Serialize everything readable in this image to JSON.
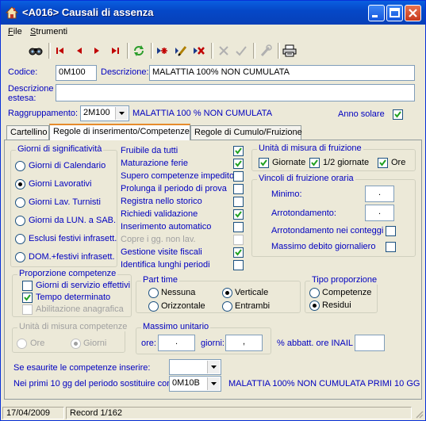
{
  "window": {
    "title": "<A016> Causali di assenza"
  },
  "menu": [
    {
      "label": "File",
      "key": "F",
      "rest": "ile"
    },
    {
      "label": "Strumenti",
      "key": "S",
      "rest": "trumenti"
    }
  ],
  "toolbar": [
    "search-icon",
    "first-record-icon",
    "prev-record-icon",
    "next-record-icon",
    "last-record-icon",
    "refresh-icon",
    "new-record-icon",
    "edit-icon",
    "delete-icon",
    "cancel-icon",
    "confirm-icon",
    "tool-icon",
    "print-icon"
  ],
  "header": {
    "codice_label": "Codice:",
    "codice_value": "0M100",
    "descrizione_label": "Descrizione:",
    "descrizione_value": "MALATTIA 100% NON CUMULATA",
    "desc_estesa_label1": "Descrizione",
    "desc_estesa_label2": "estesa:",
    "desc_estesa_value": "",
    "raggruppamento_label": "Raggruppamento:",
    "raggruppamento_value": "2M100",
    "raggruppamento_desc": "MALATTIA 100 % NON CUMULATA",
    "anno_solare_label": "Anno solare",
    "anno_solare_checked": true
  },
  "tabs": [
    "Cartellino",
    "Regole di inserimento/Competenze",
    "Regole di Cumulo/Fruizione"
  ],
  "active_tab": 1,
  "giorni": {
    "title": "Giorni di significatività",
    "options": [
      "Giorni di Calendario",
      "Giorni Lavorativi",
      "Giorni Lav. Turnisti",
      "Giorni da LUN. a SAB.",
      "Esclusi festivi infrasett.",
      "DOM.+festivi infrasett."
    ],
    "selected": 1
  },
  "flags": [
    {
      "label": "Fruibile da tutti",
      "checked": true,
      "disabled": false
    },
    {
      "label": "Maturazione ferie",
      "checked": true,
      "disabled": false
    },
    {
      "label": "Supero competenze impedito",
      "checked": false,
      "disabled": false
    },
    {
      "label": "Prolunga il periodo di prova",
      "checked": false,
      "disabled": false
    },
    {
      "label": "Registra nello storico",
      "checked": false,
      "disabled": false
    },
    {
      "label": "Richiedi validazione",
      "checked": true,
      "disabled": false
    },
    {
      "label": "Inserimento automatico",
      "checked": false,
      "disabled": false
    },
    {
      "label": "Copre i gg. non lav.",
      "checked": false,
      "disabled": true
    },
    {
      "label": "Gestione visite fiscali",
      "checked": true,
      "disabled": false
    },
    {
      "label": "Identifica lunghi periodi",
      "checked": false,
      "disabled": false
    }
  ],
  "unita_fruizione": {
    "title": "Unità di misura di fruizione",
    "options": [
      {
        "label": "Giornate",
        "checked": true
      },
      {
        "label": "1/2 giornate",
        "checked": true
      },
      {
        "label": "Ore",
        "checked": true
      }
    ]
  },
  "vincoli": {
    "title": "Vincoli di fruizione oraria",
    "minimo_label": "Minimo:",
    "minimo_value": ".",
    "arrotondamento_label": "Arrotondamento:",
    "arrotondamento_value": ".",
    "arr_conteggi_label": "Arrotondamento nei conteggi",
    "arr_conteggi_checked": false,
    "massimo_label": "Massimo debito giornaliero",
    "massimo_checked": false
  },
  "proporzione": {
    "title": "Proporzione competenze",
    "options": [
      {
        "label": "Giorni di servizio effettivi",
        "checked": false,
        "disabled": false
      },
      {
        "label": "Tempo determinato",
        "checked": true,
        "disabled": false
      },
      {
        "label": "Abilitazione anagrafica",
        "checked": false,
        "disabled": true
      }
    ]
  },
  "part_time": {
    "title": "Part time",
    "options": [
      "Nessuna",
      "Verticale",
      "Orizzontale",
      "Entrambi"
    ],
    "selected": 1
  },
  "tipo_proporzione": {
    "title": "Tipo proporzione",
    "options": [
      "Competenze",
      "Residui"
    ],
    "selected": 1
  },
  "unita_competenze": {
    "title": "Unità di misura competenze",
    "options": [
      "Ore",
      "Giorni"
    ],
    "selected": 1
  },
  "massimo_unitario": {
    "title": "Massimo unitario",
    "ore_label": "ore:",
    "ore_value": ".",
    "giorni_label": "giorni:",
    "giorni_value": ","
  },
  "abbatt": {
    "label": "% abbatt. ore INAIL",
    "value": ""
  },
  "esaurite": {
    "label": "Se esaurite le competenze inserire:",
    "value": ""
  },
  "primi10": {
    "label": "Nei primi 10 gg del periodo sostituire con:",
    "value": "0M10B",
    "desc": "MALATTIA 100% NON CUMULATA PRIMI 10 GG"
  },
  "status": {
    "date": "17/04/2009",
    "record": "Record 1/162"
  }
}
